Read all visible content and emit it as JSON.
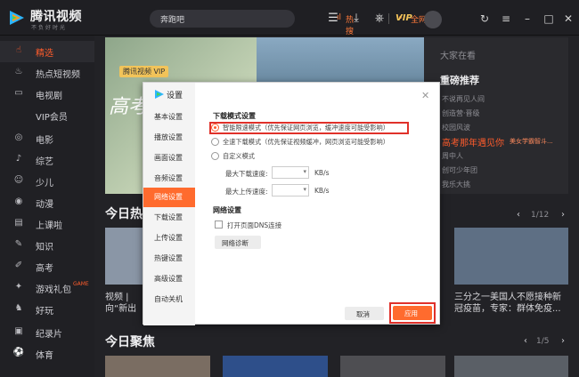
{
  "app": {
    "name": "腾讯视频",
    "slogan": "不负好时光"
  },
  "search": {
    "text": "奔跑吧",
    "hot_label": "热搜榜",
    "net_label": "全网搜"
  },
  "topbar": {
    "vip": "VIP"
  },
  "sidebar": {
    "items": [
      {
        "icon": "thumbs-up-icon",
        "label": "精选",
        "active": true
      },
      {
        "icon": "fire-icon",
        "label": "热点短视频"
      },
      {
        "icon": "tv-icon",
        "label": "电视剧"
      },
      {
        "icon": "",
        "label": "VIP会员"
      },
      {
        "icon": "movie-icon",
        "label": "电影"
      },
      {
        "icon": "mic-icon",
        "label": "综艺"
      },
      {
        "icon": "kids-icon",
        "label": "少儿"
      },
      {
        "icon": "anime-icon",
        "label": "动漫"
      },
      {
        "icon": "class-icon",
        "label": "上课啦"
      },
      {
        "icon": "knowledge-icon",
        "label": "知识"
      },
      {
        "icon": "exam-icon",
        "label": "高考"
      },
      {
        "icon": "gift-icon",
        "label": "游戏礼包"
      },
      {
        "icon": "fun-icon",
        "label": "好玩"
      },
      {
        "icon": "documentary-icon",
        "label": "纪录片"
      },
      {
        "icon": "sports-icon",
        "label": "体育"
      }
    ],
    "game_tag": "GAME"
  },
  "banner": {
    "vip_tag": "腾讯视频 VIP",
    "title": "高考"
  },
  "side_panel": {
    "header": "大家在看",
    "title": "重磅推荐",
    "items": [
      "不说再见人间",
      "创造营·晋级",
      "校园风波",
      "高考那年遇见你",
      "周中人",
      "创可少年团",
      "我乐大挑"
    ],
    "hot_sub": "美女学霸智斗..."
  },
  "sections": {
    "today_hot": "今日热",
    "today_hot_pager": "1/12",
    "today_focus": "今日聚焦",
    "today_focus_pager": "1/5"
  },
  "cards": {
    "left_caption_1": "视频 |",
    "left_caption_2": "向“新出",
    "right_caption_1": "三分之一美国人不愿接种新",
    "right_caption_2": "冠疫苗，专家：群体免疫..."
  },
  "settings_modal": {
    "title": "设置",
    "nav": [
      {
        "label": "基本设置"
      },
      {
        "label": "播放设置"
      },
      {
        "label": "画面设置"
      },
      {
        "label": "音频设置"
      },
      {
        "label": "网络设置",
        "active": true
      },
      {
        "label": "下载设置"
      },
      {
        "label": "上传设置"
      },
      {
        "label": "热键设置"
      },
      {
        "label": "高级设置"
      },
      {
        "label": "自动关机"
      }
    ],
    "download_mode_title": "下载模式设置",
    "modes": [
      {
        "label": "智能限速模式（优先保证网页浏览，缓冲速度可能受影响）",
        "checked": true
      },
      {
        "label": "全速下载模式（优先保证视频缓冲，网页浏览可能受影响）",
        "checked": false
      },
      {
        "label": "自定义模式",
        "checked": false
      }
    ],
    "max_download_label": "最大下载速度:",
    "max_upload_label": "最大上传速度:",
    "speed_unit": "KB/s",
    "network_title": "网络设置",
    "dns_label": "打开页面DNS连接",
    "diag_button": "网络诊断",
    "cancel_button": "取消",
    "apply_button": "应用"
  },
  "colors": {
    "accent": "#ff6b2e",
    "highlight": "#e0312a"
  }
}
